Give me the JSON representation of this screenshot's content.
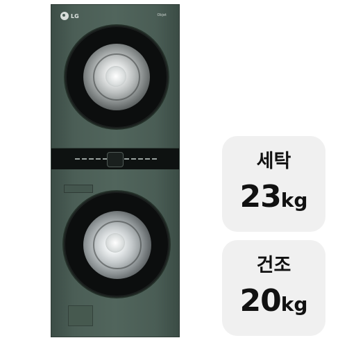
{
  "product": {
    "brand_logo": "LG",
    "model_mark": "Objet",
    "colors": {
      "body": "#4b5e56",
      "panel": "#0e1211",
      "badge_bg": "#f0f0f0"
    }
  },
  "badges": [
    {
      "label": "세탁",
      "value": "23",
      "unit": "kg"
    },
    {
      "label": "건조",
      "value": "20",
      "unit": "kg"
    }
  ]
}
